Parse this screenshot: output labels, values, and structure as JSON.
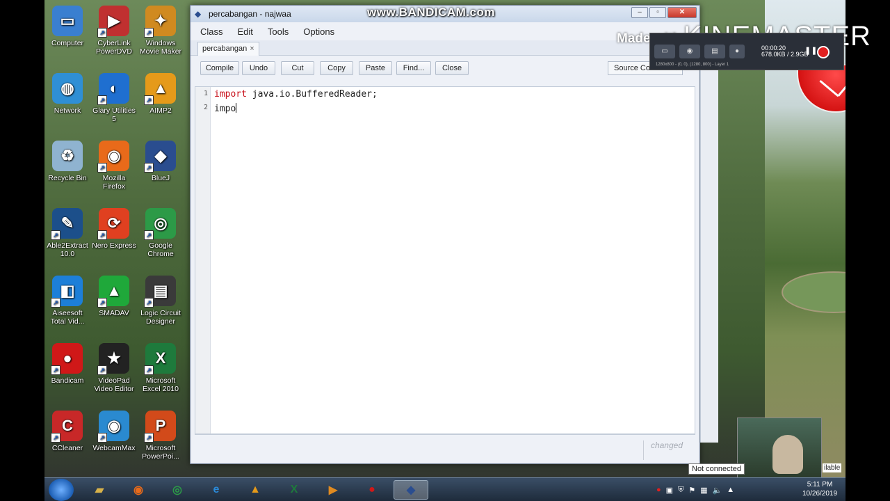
{
  "window": {
    "title": "percabangan - najwaa",
    "watermark": "www.BANDICAM.com"
  },
  "menu": [
    "Class",
    "Edit",
    "Tools",
    "Options"
  ],
  "tab": {
    "label": "percabangan",
    "close": "×"
  },
  "toolbar": {
    "compile": "Compile",
    "undo": "Undo",
    "cut": "Cut",
    "copy": "Copy",
    "paste": "Paste",
    "find": "Find...",
    "close": "Close",
    "view_select": "Source Code"
  },
  "editor": {
    "lines": [
      {
        "num": "1",
        "keyword": "import",
        "rest": " java.io.BufferedReader;"
      },
      {
        "num": "2",
        "keyword": "",
        "rest": "impo"
      }
    ]
  },
  "status": {
    "changed": "changed"
  },
  "overlay": {
    "kinemaster_small": "Made with",
    "kinemaster_big": "KINEMASTER",
    "bandicam_time": "00:00:20",
    "bandicam_size": "678.0KB / 2.9GB",
    "bandicam_info": "1280x800 - (0, 0), (1280, 800) - Layer 1",
    "not_connected": "Not connected",
    "available": "ilable"
  },
  "desktop": {
    "icons": [
      {
        "label": "Computer",
        "icon": "computer-icon",
        "color": "#3a7fd0"
      },
      {
        "label": "CyberLink PowerDVD",
        "icon": "powerdvd-icon",
        "color": "#c03030"
      },
      {
        "label": "Windows Movie Maker",
        "icon": "moviemaker-icon",
        "color": "#d08a20"
      },
      {
        "label": "Network",
        "icon": "network-icon",
        "color": "#2f8fd5"
      },
      {
        "label": "Glary Utilities 5",
        "icon": "glary-icon",
        "color": "#1f6fd0"
      },
      {
        "label": "AIMP2",
        "icon": "aimp-icon",
        "color": "#e59a1a"
      },
      {
        "label": "Recycle Bin",
        "icon": "recycle-bin-icon",
        "color": "#8fb3d0"
      },
      {
        "label": "Mozilla Firefox",
        "icon": "firefox-icon",
        "color": "#e86a1a"
      },
      {
        "label": "BlueJ",
        "icon": "bluej-icon",
        "color": "#2a4d8f"
      },
      {
        "label": "Able2Extract 10.0",
        "icon": "able2extract-icon",
        "color": "#1c4f8a"
      },
      {
        "label": "Nero Express",
        "icon": "nero-icon",
        "color": "#e04020"
      },
      {
        "label": "Google Chrome",
        "icon": "chrome-icon",
        "color": "#2c9a47"
      },
      {
        "label": "Aiseesoft Total Vid...",
        "icon": "aiseesoft-icon",
        "color": "#1d7fd8"
      },
      {
        "label": "SMADAV",
        "icon": "smadav-icon",
        "color": "#1fa83a"
      },
      {
        "label": "Logic Circuit Designer",
        "icon": "logic-circuit-icon",
        "color": "#3a3a3a"
      },
      {
        "label": "Bandicam",
        "icon": "bandicam-icon",
        "color": "#d01818"
      },
      {
        "label": "VideoPad Video Editor",
        "icon": "videopad-icon",
        "color": "#222222"
      },
      {
        "label": "Microsoft Excel 2010",
        "icon": "excel-icon",
        "color": "#1e7a3c"
      },
      {
        "label": "CCleaner",
        "icon": "ccleaner-icon",
        "color": "#c82828"
      },
      {
        "label": "WebcamMax",
        "icon": "webcammax-icon",
        "color": "#2a8ad0"
      },
      {
        "label": "Microsoft PowerPoi...",
        "icon": "powerpoint-icon",
        "color": "#d24a1a"
      }
    ]
  },
  "taskbar": {
    "items": [
      {
        "icon": "explorer-icon",
        "color": "#d8b24a"
      },
      {
        "icon": "firefox-icon",
        "color": "#e86a1a"
      },
      {
        "icon": "chrome-icon",
        "color": "#2c9a47"
      },
      {
        "icon": "internet-explorer-icon",
        "color": "#2a8ad8"
      },
      {
        "icon": "aimp-icon",
        "color": "#e59a1a"
      },
      {
        "icon": "excel-icon",
        "color": "#1e7a3c"
      },
      {
        "icon": "media-player-icon",
        "color": "#e08a20"
      },
      {
        "icon": "bandicam-icon",
        "color": "#d01818"
      },
      {
        "icon": "bluej-icon",
        "color": "#2a4d8f"
      }
    ],
    "time": "5:11 PM",
    "date": "10/26/2019"
  }
}
